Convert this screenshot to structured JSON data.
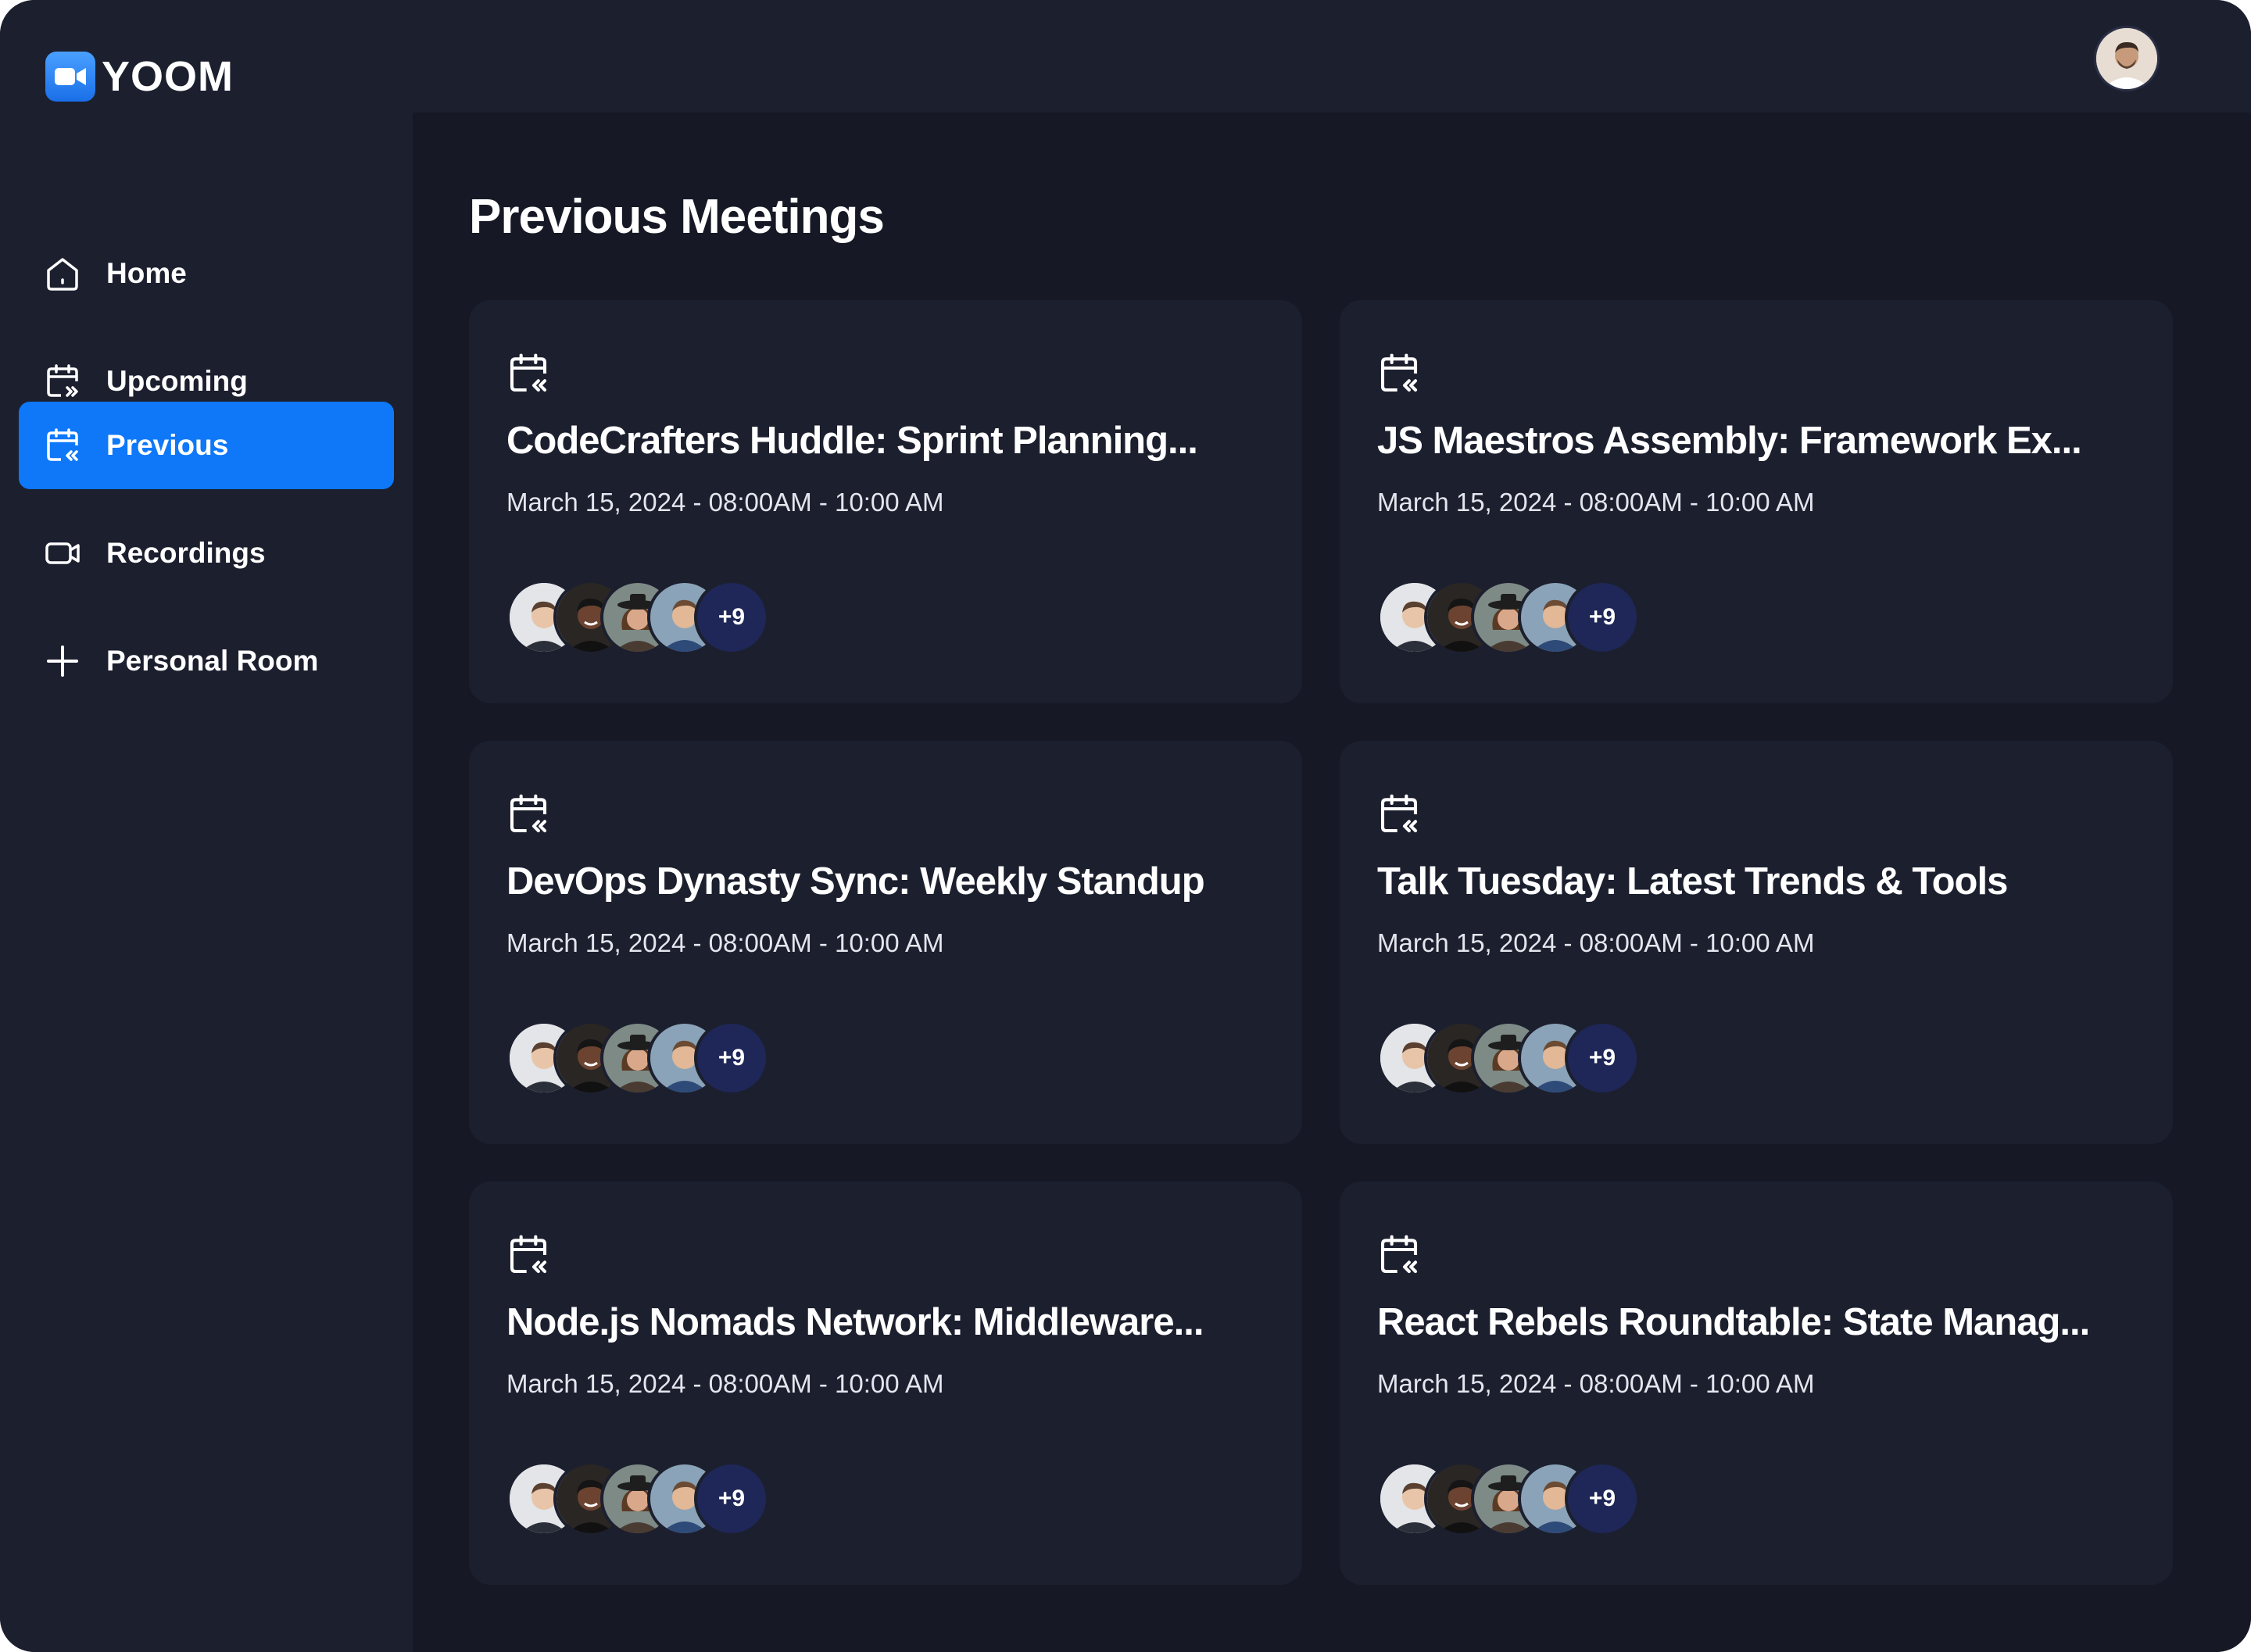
{
  "app": {
    "name": "YOOM"
  },
  "sidebar": {
    "items": [
      {
        "label": "Home",
        "icon": "home-icon",
        "active": false
      },
      {
        "label": "Upcoming",
        "icon": "calendar-forward-icon",
        "active": false
      },
      {
        "label": "Previous",
        "icon": "calendar-back-icon",
        "active": true
      },
      {
        "label": "Recordings",
        "icon": "video-icon",
        "active": false
      },
      {
        "label": "Personal Room",
        "icon": "plus-icon",
        "active": false
      }
    ]
  },
  "main": {
    "title": "Previous Meetings",
    "meetings": [
      {
        "title": "CodeCrafters Huddle: Sprint Planning...",
        "date": "March 15, 2024 -  08:00AM - 10:00 AM",
        "more": "+9"
      },
      {
        "title": "JS Maestros Assembly: Framework Ex...",
        "date": "March 15, 2024 -  08:00AM - 10:00 AM",
        "more": "+9"
      },
      {
        "title": "DevOps Dynasty Sync: Weekly Standup",
        "date": "March 15, 2024 -  08:00AM - 10:00 AM",
        "more": "+9"
      },
      {
        "title": "Talk Tuesday: Latest Trends & Tools",
        "date": "March 15, 2024 -  08:00AM - 10:00 AM",
        "more": "+9"
      },
      {
        "title": "Node.js Nomads Network: Middleware...",
        "date": "March 15, 2024 -  08:00AM - 10:00 AM",
        "more": "+9"
      },
      {
        "title": "React Rebels Roundtable: State Manag...",
        "date": "March 15, 2024 -  08:00AM - 10:00 AM",
        "more": "+9"
      }
    ]
  },
  "colors": {
    "accent": "#0e78f9",
    "sidebar_bg": "#1c1f2e",
    "main_bg": "#161925",
    "card_bg": "#1c1f2e"
  }
}
